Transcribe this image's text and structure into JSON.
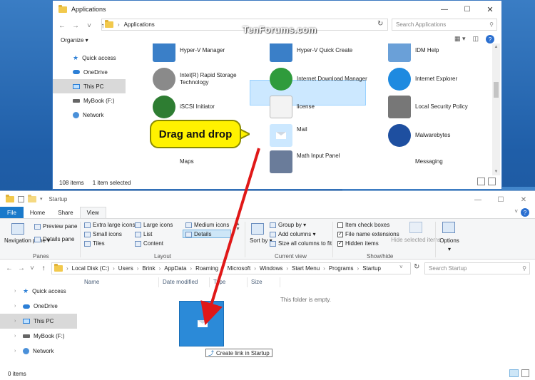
{
  "watermark": "TenForums.com",
  "top_window": {
    "title": "Applications",
    "breadcrumb": [
      "Applications"
    ],
    "search_placeholder": "Search Applications",
    "organize_label": "Organize ▾",
    "nav_items": [
      {
        "label": "Quick access",
        "icon": "star-icon"
      },
      {
        "label": "OneDrive",
        "icon": "cloud-icon"
      },
      {
        "label": "This PC",
        "icon": "pc-icon",
        "selected": true
      },
      {
        "label": "MyBook (F:)",
        "icon": "drive-icon"
      },
      {
        "label": "Network",
        "icon": "network-icon"
      }
    ],
    "items": [
      {
        "label": "Hyper-V Manager",
        "color": "#3a7fc8"
      },
      {
        "label": "Hyper-V Quick Create",
        "color": "#3a7fc8"
      },
      {
        "label": "IDM Help",
        "color": "#6aa0d8"
      },
      {
        "label": "Intel(R) Rapid Storage Technology",
        "color": "#8a8a8a"
      },
      {
        "label": "Internet Download Manager",
        "color": "#2f9b3c"
      },
      {
        "label": "Internet Explorer",
        "color": "#1e8ae0"
      },
      {
        "label": "iSCSI Initiator",
        "color": "#2e7d32"
      },
      {
        "label": "license",
        "color": "#e8e8e8"
      },
      {
        "label": "Local Security Policy",
        "color": "#777777"
      },
      {
        "label": "Mail",
        "color": "#cce8ff"
      },
      {
        "label": "Malwarebytes",
        "color": "#1e4fa0"
      },
      {
        "label": "Maps",
        "color": "#ffffff"
      },
      {
        "label": "Math Input Panel",
        "color": "#6a7c9a"
      },
      {
        "label": "Messaging",
        "color": "#ffffff"
      }
    ],
    "status_count": "108 items",
    "status_selected": "1 item selected"
  },
  "callout": "Drag and drop",
  "bottom_window": {
    "title": "Startup",
    "tabs": [
      "File",
      "Home",
      "Share",
      "View"
    ],
    "panes": {
      "navigation_pane": "Navigation pane ▾",
      "preview_pane": "Preview pane",
      "details_pane": "Details pane",
      "group": "Panes"
    },
    "layout": {
      "options": [
        "Extra large icons",
        "Large icons",
        "Medium icons",
        "Small icons",
        "List",
        "Details",
        "Tiles",
        "Content"
      ],
      "group": "Layout"
    },
    "current_view": {
      "sort_by": "Sort by ▾",
      "group_by": "Group by ▾",
      "add_columns": "Add columns ▾",
      "size_all": "Size all columns to fit",
      "group": "Current view"
    },
    "show_hide": {
      "item_check_boxes": "Item check boxes",
      "file_name_extensions": "File name extensions",
      "hidden_items": "Hidden items",
      "hide_selected": "Hide selected items",
      "group": "Show/hide"
    },
    "options_label": "Options",
    "breadcrumb": [
      "Local Disk (C:)",
      "Users",
      "Brink",
      "AppData",
      "Roaming",
      "Microsoft",
      "Windows",
      "Start Menu",
      "Programs",
      "Startup"
    ],
    "search_placeholder": "Search Startup",
    "nav_items": [
      {
        "label": "Quick access",
        "icon": "star-icon"
      },
      {
        "label": "OneDrive",
        "icon": "cloud-icon"
      },
      {
        "label": "This PC",
        "icon": "pc-icon",
        "selected": true
      },
      {
        "label": "MyBook (F:)",
        "icon": "drive-icon"
      },
      {
        "label": "Network",
        "icon": "network-icon"
      }
    ],
    "columns": [
      "Name",
      "Date modified",
      "Type",
      "Size"
    ],
    "empty_message": "This folder is empty.",
    "tooltip": "Create link in Startup",
    "status": "0 items"
  }
}
